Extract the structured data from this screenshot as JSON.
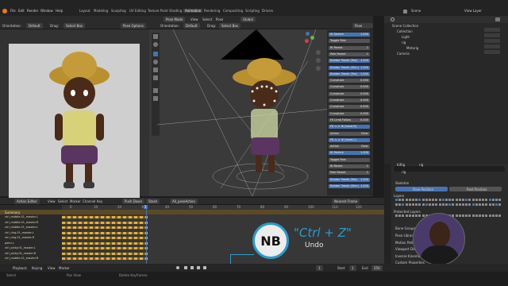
{
  "menu": [
    "File",
    "Edit",
    "Render",
    "Window",
    "Help"
  ],
  "workspace_tabs": [
    "Layout",
    "Modeling",
    "Sculpting",
    "UV Editing",
    "Texture Paint",
    "Shading",
    "Animation",
    "Rendering",
    "Compositing",
    "Scripting",
    "Drivers"
  ],
  "active_tab": "Animation",
  "scene_label": "Scene",
  "view_layer_label": "View Layer",
  "left_view": {
    "orientation_label": "Orientation:",
    "orientation_value": "Default",
    "drag_label": "Drag:",
    "select_box": "Select Box"
  },
  "left_header": {
    "mode": "Pose Options"
  },
  "viewport_header": {
    "mode": "Pose Mode",
    "view": "View",
    "select": "Select",
    "pose": "Pose",
    "orientation": "Global",
    "pose_options": "Pose Options"
  },
  "viewport_subheader": {
    "orientation_label": "Orientation:",
    "orientation_value": "Default",
    "drag_label": "Drag:",
    "select_box": "Select Box"
  },
  "props": [
    {
      "label": "IK Stretch",
      "value": "1.000",
      "style": "blue"
    },
    {
      "label": "Toggle Pole",
      "value": "",
      "style": "grey"
    },
    {
      "label": "IK Parent",
      "value": "1",
      "style": "grey"
    },
    {
      "label": "Pole Parent",
      "value": "1",
      "style": "grey"
    },
    {
      "label": "Rubber Tweak (Toe)",
      "value": "1.000",
      "style": "blue"
    },
    {
      "label": "Rubber Tweak (Shin)",
      "value": "1.000",
      "style": "blue"
    },
    {
      "label": "Rubber Tweak (Toe)",
      "value": "1.000",
      "style": "blue"
    },
    {
      "label": "Curvature",
      "value": "0.000",
      "style": "grey"
    },
    {
      "label": "Curvature",
      "value": "0.000",
      "style": "grey"
    },
    {
      "label": "Curvature",
      "value": "0.000",
      "style": "grey"
    },
    {
      "label": "Curvature",
      "value": "0.000",
      "style": "grey"
    },
    {
      "label": "Curvature",
      "value": "0.000",
      "style": "grey"
    },
    {
      "label": "Curvature",
      "value": "0.000",
      "style": "grey"
    },
    {
      "label": "FK Limb Follow",
      "value": "0.000",
      "style": "grey"
    },
    {
      "label": "FK <-> IK (hand.R)",
      "value": "",
      "style": "blue"
    },
    {
      "label": "Action",
      "value": "Clear",
      "style": "grey"
    },
    {
      "label": "FK <-> IK (hand.L)",
      "value": "",
      "style": "blue"
    },
    {
      "label": "Action",
      "value": "Clear",
      "style": "grey"
    },
    {
      "label": "IK Stretch",
      "value": "1.000",
      "style": "blue"
    },
    {
      "label": "Toggle Pole",
      "value": "",
      "style": "grey"
    },
    {
      "label": "IK Parent",
      "value": "1",
      "style": "grey"
    },
    {
      "label": "Pole Parent",
      "value": "1",
      "style": "grey"
    },
    {
      "label": "Rubber Tweak (Toe)",
      "value": "1.000",
      "style": "blue"
    },
    {
      "label": "Rubber Tweak (Shin)",
      "value": "1.000",
      "style": "blue"
    }
  ],
  "outliner": {
    "title": "Scene Collection",
    "items": [
      "Collection",
      "Light",
      "rig",
      "Metarig",
      "Camera"
    ],
    "bottom": "Scene Collection"
  },
  "properties_panel": {
    "object": "KiRig",
    "data": "rig",
    "search": "rig",
    "sections": [
      "Skeleton",
      "Bone Groups",
      "Pose Library",
      "Motion Paths",
      "Viewport Display",
      "Inverse Kinematics",
      "Custom Properties"
    ],
    "pose_position": "Pose Position",
    "rest_position": "Rest Position",
    "layers_label": "Layers",
    "protected_label": "Protected Layers"
  },
  "dope_sheet": {
    "mode": "Action Editor",
    "menu": [
      "View",
      "Select",
      "Marker",
      "Channel",
      "Key"
    ],
    "push_down": "Push Down",
    "stash": "Stash",
    "action": "All_poseAction",
    "summary": "Summary",
    "channels": [
      "ctrl_middle.01_master.L",
      "ctrl_middle.01_master.R",
      "ctrl_middle.01_master.L",
      "ctrl_ring.01_master.L",
      "ctrl_ring.01_master.R",
      "palm.L",
      "ctrl_pinky.01_master.L",
      "ctrl_pinky.01_master.R",
      "ctrl_middle.01_master.R"
    ],
    "frames": [
      "0",
      "10",
      "20",
      "30",
      "40",
      "50",
      "60",
      "70",
      "80",
      "90",
      "100",
      "110",
      "120"
    ],
    "current_frame": "1",
    "keying": "Nearest Frame"
  },
  "playback": {
    "playback": "Playback",
    "keying": "Keying",
    "view": "View",
    "marker": "Marker",
    "start_label": "Start",
    "start": "1",
    "end_label": "End",
    "end": "250",
    "current": "1"
  },
  "overlay": {
    "badge": "NB",
    "shortcut": "\"Ctrl + Z\"",
    "action": "Undo"
  },
  "status": {
    "left": "Select",
    "middle": "Pan View",
    "right": "Delete Keyframes"
  },
  "colors": {
    "accent": "#4772b3",
    "keyframe": "#e3b13c",
    "overlay": "#2b9acb",
    "bg": "#1d1d1d"
  }
}
